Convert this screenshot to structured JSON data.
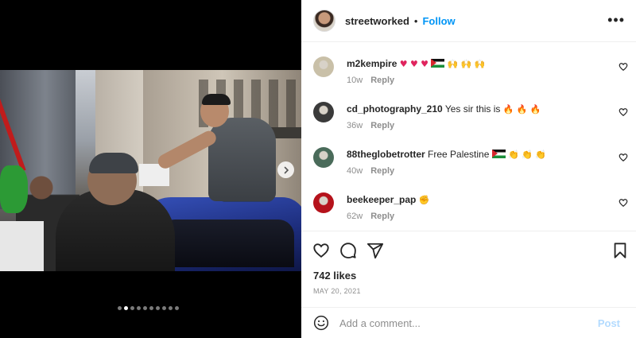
{
  "post": {
    "username": "streetworked",
    "bullet": "•",
    "follow_label": "Follow",
    "more_label": "•••",
    "likes": "742 likes",
    "date": "MAY 20, 2021",
    "carousel": {
      "count": 10,
      "active_index": 1
    }
  },
  "comments": [
    {
      "user": "m2kempire",
      "text": "",
      "emojis": [
        "heart",
        "heart",
        "heart",
        "flag",
        "raised-hands",
        "raised-hands",
        "raised-hands"
      ],
      "time": "10w",
      "reply_label": "Reply",
      "avatar_color": "#c9c0a8"
    },
    {
      "user": "cd_photography_210",
      "text": "Yes sir this is",
      "emojis": [
        "fire",
        "fire",
        "fire"
      ],
      "time": "36w",
      "reply_label": "Reply",
      "avatar_color": "#3a3a3a"
    },
    {
      "user": "88theglobetrotter",
      "text": "Free Palestine",
      "emojis": [
        "flag",
        "clap",
        "clap",
        "clap"
      ],
      "time": "40w",
      "reply_label": "Reply",
      "avatar_color": "#4a6b5a"
    },
    {
      "user": "beekeeper_pap",
      "text": "",
      "emojis": [
        "fist"
      ],
      "time": "62w",
      "reply_label": "Reply",
      "avatar_color": "#b5121b"
    }
  ],
  "add_comment": {
    "placeholder": "Add a comment...",
    "post_label": "Post"
  },
  "icons": {
    "like": "heart-outline-icon",
    "comment": "speech-bubble-icon",
    "share": "paper-plane-icon",
    "save": "bookmark-icon",
    "emoji": "smiley-icon",
    "next": "chevron-right-icon"
  },
  "colors": {
    "link_blue": "#0095f6",
    "post_disabled": "#b3dbff",
    "muted": "#8e8e8e"
  }
}
